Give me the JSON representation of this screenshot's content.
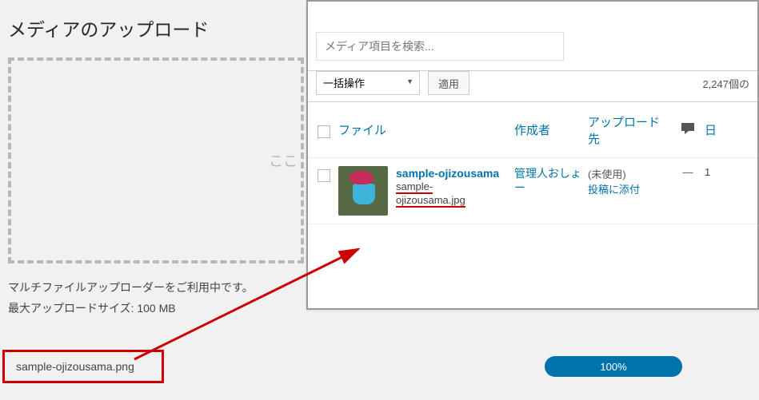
{
  "upload": {
    "title": "メディアのアップロード",
    "dropzone_hint": "ここ",
    "uploader_info": "マルチファイルアップローダーをご利用中です。",
    "max_size": "最大アップロードサイズ: 100 MB",
    "filename": "sample-ojizousama.png",
    "progress": "100%"
  },
  "library": {
    "search_placeholder": "メディア項目を検索...",
    "bulk_action": "一括操作",
    "apply": "適用",
    "count": "2,247個の",
    "columns": {
      "file": "ファイル",
      "author": "作成者",
      "attached": "アップロード先",
      "date": "日"
    },
    "row": {
      "title": "sample-ojizousama",
      "filename_part1": "sample-",
      "filename_part2": "ojizousama.jpg",
      "author": "管理人おしょー",
      "attached_unused": "(未使用)",
      "attached_link": "投稿に添付",
      "comments": "—",
      "date": "1"
    }
  }
}
